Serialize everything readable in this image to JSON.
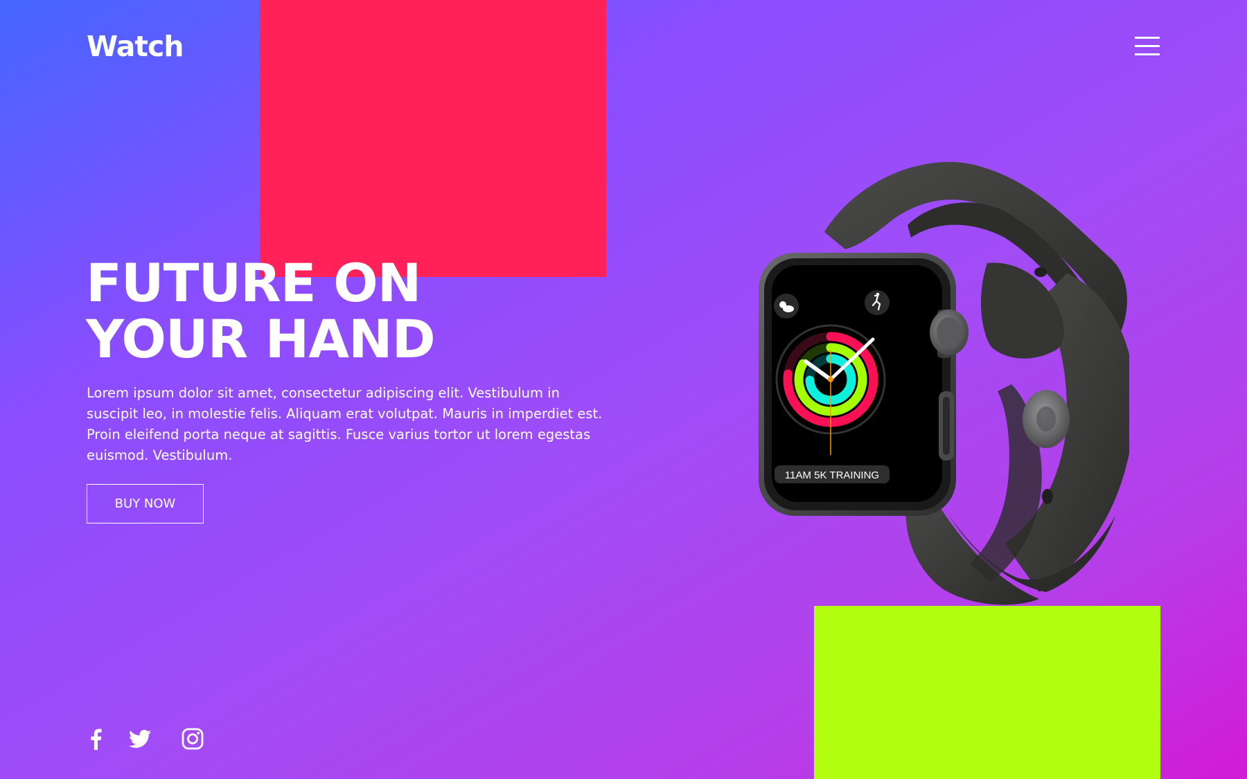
{
  "brand": {
    "logo": "Watch"
  },
  "nav": {
    "menu_icon": "hamburger-menu-icon"
  },
  "hero": {
    "title_line1": "FUTURE ON",
    "title_line2": "YOUR HAND",
    "body": "Lorem ipsum dolor sit amet, consectetur adipiscing elit. Vestibulum in suscipit leo, in molestie felis. Aliquam erat volutpat. Mauris in imperdiet est. Proin eleifend porta neque at sagittis. Fusce varius tortor ut lorem egestas euismod. Vestibulum.",
    "cta_label": "BUY NOW"
  },
  "product": {
    "watch_screen_text": "11AM 5K TRAINING"
  },
  "social": {
    "icons": [
      "facebook-icon",
      "twitter-icon",
      "instagram-icon"
    ]
  },
  "colors": {
    "gradient_start": "#4466ff",
    "gradient_end": "#d21bd6",
    "accent_red": "#ff2158",
    "accent_lime": "#b3ff12",
    "text": "#ffffff"
  }
}
